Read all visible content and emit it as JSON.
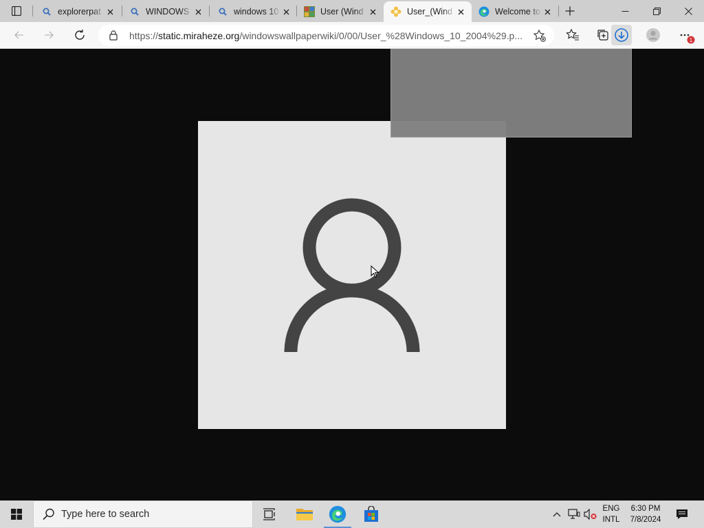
{
  "browser": {
    "tabs": [
      {
        "title": "explorerpat",
        "icon": "search-icon",
        "active": false
      },
      {
        "title": "WINDOWS",
        "icon": "search-icon",
        "active": false
      },
      {
        "title": "windows 10",
        "icon": "search-icon",
        "active": false
      },
      {
        "title": "User (Wind",
        "icon": "wiki-site-icon",
        "active": false
      },
      {
        "title": "User_(Wind",
        "icon": "flower-icon",
        "active": true
      },
      {
        "title": "Welcome to",
        "icon": "edge-icon",
        "active": false
      }
    ],
    "address": {
      "scheme": "https://",
      "host": "static.miraheze.org",
      "path": "/windowswallpaperwiki/0/00/User_%28Windows_10_2004%29.p..."
    },
    "notification_badge": "1"
  },
  "content": {
    "background": "#0c0c0c",
    "image_background": "#e6e6e6",
    "icon_color": "#444444",
    "image_subject": "user-silhouette-icon"
  },
  "taskbar": {
    "search_placeholder": "Type here to search",
    "pinned_apps": [
      "task-view-icon",
      "file-explorer-icon",
      "edge-icon",
      "store-icon"
    ],
    "language_line1": "ENG",
    "language_line2": "INTL",
    "time": "6:30 PM",
    "date": "7/8/2024"
  },
  "colors": {
    "titlebar": "#cfcfcf",
    "toolbar": "#f7f7f7",
    "taskbar": "#d9d9d9",
    "accent": "#5c8fd6",
    "download_accent": "#1a6fd4",
    "badge": "#d13438"
  }
}
